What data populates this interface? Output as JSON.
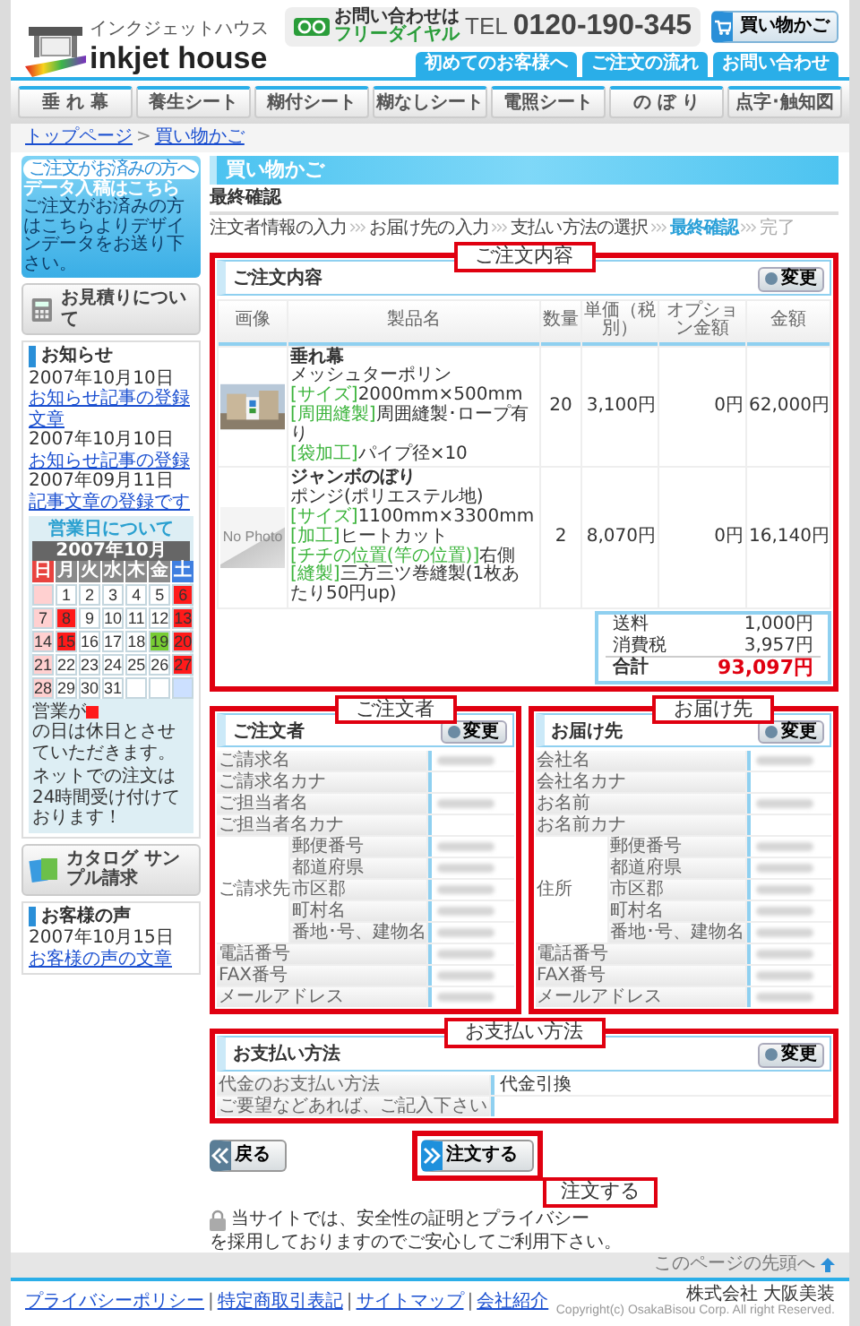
{
  "header": {
    "logo_kana": "インクジェットハウス",
    "logo": "inkjet house",
    "contact_label": "お問い合わせは",
    "freedial_label": "フリーダイヤル",
    "tel_label": "TEL",
    "tel": "0120-190-345",
    "cart_button": "買い物かご",
    "tabs": [
      "初めてのお客様へ",
      "ご注文の流れ",
      "お問い合わせ"
    ]
  },
  "nav": [
    "垂 れ 幕",
    "養生シート",
    "糊付シート",
    "糊なしシート",
    "電照シート",
    "の ぼ り",
    "点字･触知図"
  ],
  "breadcrumb": [
    "トップページ",
    "買い物かご"
  ],
  "breadcrumb_separator": ">",
  "sidebar": {
    "upload_banner": {
      "kicker": "ご注文がお済みの方へ",
      "title": "データ入稿はこちら",
      "text": "ご注文がお済みの方はこちらよりデザインデータをお送り下さい。"
    },
    "estimate": "お見積りについて",
    "news": {
      "title": "お知らせ",
      "items": [
        {
          "date": "2007年10月10日",
          "link": "お知らせ記事の登録文章"
        },
        {
          "date": "2007年10月10日",
          "link": "お知らせ記事の登録"
        },
        {
          "date": "2007年09月11日",
          "link": "記事文章の登録です"
        }
      ]
    },
    "calendar": {
      "title": "営業日について",
      "month": "2007年10月",
      "weekdays": [
        {
          "label": "日",
          "color": "#e8433f"
        },
        {
          "label": "月",
          "color": "#8a8a8a"
        },
        {
          "label": "火",
          "color": "#8a8a8a"
        },
        {
          "label": "水",
          "color": "#8a8a8a"
        },
        {
          "label": "木",
          "color": "#8a8a8a"
        },
        {
          "label": "金",
          "color": "#8a8a8a"
        },
        {
          "label": "土",
          "color": "#3f7fe0"
        }
      ],
      "weeks": [
        [
          {
            "color": "#ffd0d0"
          },
          {
            "day": "1",
            "color": "#ffffff"
          },
          {
            "day": "2",
            "color": "#ffffff"
          },
          {
            "day": "3",
            "color": "#ffffff"
          },
          {
            "day": "4",
            "color": "#ffffff"
          },
          {
            "day": "5",
            "color": "#ffffff"
          },
          {
            "day": "6",
            "color": "#ff1a1a"
          }
        ],
        [
          {
            "day": "7",
            "color": "#ffd0d0"
          },
          {
            "day": "8",
            "color": "#ff1a1a"
          },
          {
            "day": "9",
            "color": "#ffffff"
          },
          {
            "day": "10",
            "color": "#ffffff"
          },
          {
            "day": "11",
            "color": "#ffffff"
          },
          {
            "day": "12",
            "color": "#ffffff"
          },
          {
            "day": "13",
            "color": "#ff1a1a"
          }
        ],
        [
          {
            "day": "14",
            "color": "#ffd0d0"
          },
          {
            "day": "15",
            "color": "#ff1a1a"
          },
          {
            "day": "16",
            "color": "#ffffff"
          },
          {
            "day": "17",
            "color": "#ffffff"
          },
          {
            "day": "18",
            "color": "#ffffff"
          },
          {
            "day": "19",
            "color": "#77cc33"
          },
          {
            "day": "20",
            "color": "#ff1a1a"
          }
        ],
        [
          {
            "day": "21",
            "color": "#ffd0d0"
          },
          {
            "day": "22",
            "color": "#ffffff"
          },
          {
            "day": "23",
            "color": "#ffffff"
          },
          {
            "day": "24",
            "color": "#ffffff"
          },
          {
            "day": "25",
            "color": "#ffffff"
          },
          {
            "day": "26",
            "color": "#ffffff"
          },
          {
            "day": "27",
            "color": "#ff1a1a"
          }
        ],
        [
          {
            "day": "28",
            "color": "#ffd0d0"
          },
          {
            "day": "29",
            "color": "#ffffff"
          },
          {
            "day": "30",
            "color": "#ffffff"
          },
          {
            "day": "31",
            "color": "#ffffff"
          },
          {
            "color": "#ffffff"
          },
          {
            "color": "#ffffff"
          },
          {
            "color": "#cce0ff"
          }
        ]
      ],
      "note_before": "営業が",
      "note_after": "の日は休日とさせていただきます。",
      "note2": "ネットでの注文は24時間受け付けております！"
    },
    "catalog": "カタログ サンプル請求",
    "voices": {
      "title": "お客様の声",
      "items": [
        {
          "date": "2007年10月15日",
          "link": "お客様の声の文章"
        }
      ]
    }
  },
  "page_title": "買い物かご",
  "subtitle": "最終確認",
  "steps": [
    {
      "label": "注文者情報の入力",
      "selected": false,
      "disabled": false
    },
    {
      "label": "お届け先の入力",
      "selected": false,
      "disabled": false
    },
    {
      "label": "支払い方法の選択",
      "selected": false,
      "disabled": false
    },
    {
      "label": "最終確認",
      "selected": true,
      "disabled": false
    },
    {
      "label": "完了",
      "selected": false,
      "disabled": true
    }
  ],
  "order": {
    "callout": "ご注文内容",
    "title": "ご注文内容",
    "change_button": "変更",
    "columns": [
      "画像",
      "製品名",
      "数量",
      "単価（税別）",
      "オプション金額",
      "金額"
    ],
    "rows": [
      {
        "image": {
          "kind": "picture"
        },
        "name": "垂れ幕",
        "details": [
          {
            "text": "メッシュターポリン"
          },
          {
            "tag": "[サイズ]",
            "text": "2000mm×500mm"
          },
          {
            "tag": "[周囲縫製]",
            "text": "周囲縫製･ロープ有り"
          },
          {
            "tag": "[袋加工]",
            "text": "パイプ径×10"
          }
        ],
        "qty": "20",
        "price": "3,100円",
        "option": "0円",
        "total": "62,000円"
      },
      {
        "image": {
          "kind": "placeholder",
          "text": "No Photo"
        },
        "name": "ジャンボのぼり",
        "details": [
          {
            "text": "ポンジ(ポリエステル地)"
          },
          {
            "tag": "[サイズ]",
            "text": "1100mm×3300mm"
          },
          {
            "tag": "[加工]",
            "text": "ヒートカット"
          },
          {
            "tag": "[チチの位置(竿の位置)]",
            "text": "右側"
          },
          {
            "tag": "[縫製]",
            "text": "三方三ツ巻縫製(1枚あたり50円up)"
          }
        ],
        "qty": "2",
        "price": "8,070円",
        "option": "0円",
        "total": "16,140円"
      }
    ],
    "totals": [
      {
        "label": "送料",
        "value": "1,000円",
        "kind": "line"
      },
      {
        "label": "消費税",
        "value": "3,957円",
        "kind": "line"
      },
      {
        "label": "合計",
        "value": "93,097円",
        "kind": "grand"
      }
    ]
  },
  "address_panels": [
    {
      "callout": "ご注文者",
      "title": "ご注文者",
      "change_button": "変更",
      "rows": [
        {
          "kind": "field",
          "label": "ご請求名",
          "redacted": true
        },
        {
          "kind": "field",
          "label": "ご請求名カナ",
          "redacted": false
        },
        {
          "kind": "field",
          "label": "ご担当者名",
          "redacted": true
        },
        {
          "kind": "field",
          "label": "ご担当者名カナ",
          "redacted": false
        },
        {
          "kind": "group",
          "label": "ご請求先",
          "children": [
            {
              "label": "郵便番号",
              "redacted": true
            },
            {
              "label": "都道府県",
              "redacted": true
            },
            {
              "label": "市区郡",
              "redacted": true
            },
            {
              "label": "町村名",
              "redacted": true
            },
            {
              "label": "番地･号、建物名",
              "redacted": true
            }
          ]
        },
        {
          "kind": "field",
          "label": "電話番号",
          "redacted": true
        },
        {
          "kind": "field",
          "label": "FAX番号",
          "redacted": true
        },
        {
          "kind": "field",
          "label": "メールアドレス",
          "redacted": true
        }
      ]
    },
    {
      "callout": "お届け先",
      "title": "お届け先",
      "change_button": "変更",
      "rows": [
        {
          "kind": "field",
          "label": "会社名",
          "redacted": true
        },
        {
          "kind": "field",
          "label": "会社名カナ",
          "redacted": false
        },
        {
          "kind": "field",
          "label": "お名前",
          "redacted": true
        },
        {
          "kind": "field",
          "label": "お名前カナ",
          "redacted": false
        },
        {
          "kind": "group",
          "label": "住所",
          "children": [
            {
              "label": "郵便番号",
              "redacted": true
            },
            {
              "label": "都道府県",
              "redacted": true
            },
            {
              "label": "市区郡",
              "redacted": true
            },
            {
              "label": "町村名",
              "redacted": true
            },
            {
              "label": "番地･号、建物名",
              "redacted": true
            }
          ]
        },
        {
          "kind": "field",
          "label": "電話番号",
          "redacted": true
        },
        {
          "kind": "field",
          "label": "FAX番号",
          "redacted": true
        },
        {
          "kind": "field",
          "label": "メールアドレス",
          "redacted": true
        }
      ]
    }
  ],
  "payment": {
    "callout": "お支払い方法",
    "title": "お支払い方法",
    "change_button": "変更",
    "rows": [
      {
        "label": "代金のお支払い方法",
        "value": "代金引換"
      },
      {
        "label": "ご要望などあれば、ご記入下さい"
      }
    ]
  },
  "back_button": "戻る",
  "submit_button": "注文する",
  "submit_callout": "注文する",
  "security_before": "当サイトでは、安全性の証明とプライバシー",
  "security_after": "を採用しておりますのでご安心してご利用下さい。",
  "footer": {
    "page_top": "このページの先頭へ",
    "links": [
      "プライバシーポリシー",
      "特定商取引表記",
      "サイトマップ",
      "会社紹介"
    ],
    "link_separator": "|",
    "company": "株式会社 大阪美装",
    "copyright": "Copyright(c) OsakaBisou Corp. All right Reserved."
  }
}
